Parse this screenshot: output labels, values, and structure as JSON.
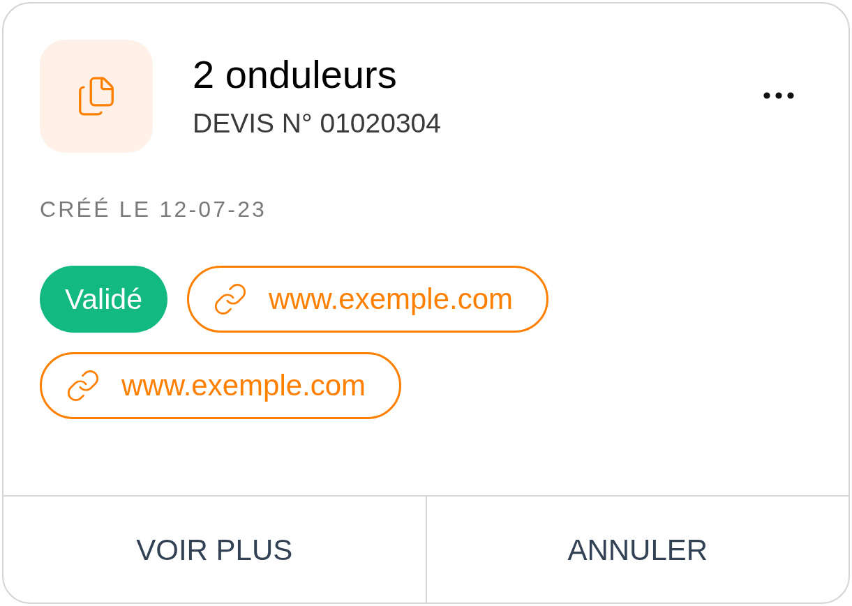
{
  "card": {
    "title": "2 onduleurs",
    "subtitle": "DEVIS N° 01020304",
    "created": "CRÉÉ LE 12-07-23",
    "tags": [
      {
        "kind": "status",
        "label": "Validé"
      },
      {
        "kind": "link",
        "label": "www.exemple.com"
      },
      {
        "kind": "link",
        "label": "www.exemple.com"
      }
    ],
    "actions": [
      "VOIR PLUS",
      "ANNULER"
    ]
  }
}
